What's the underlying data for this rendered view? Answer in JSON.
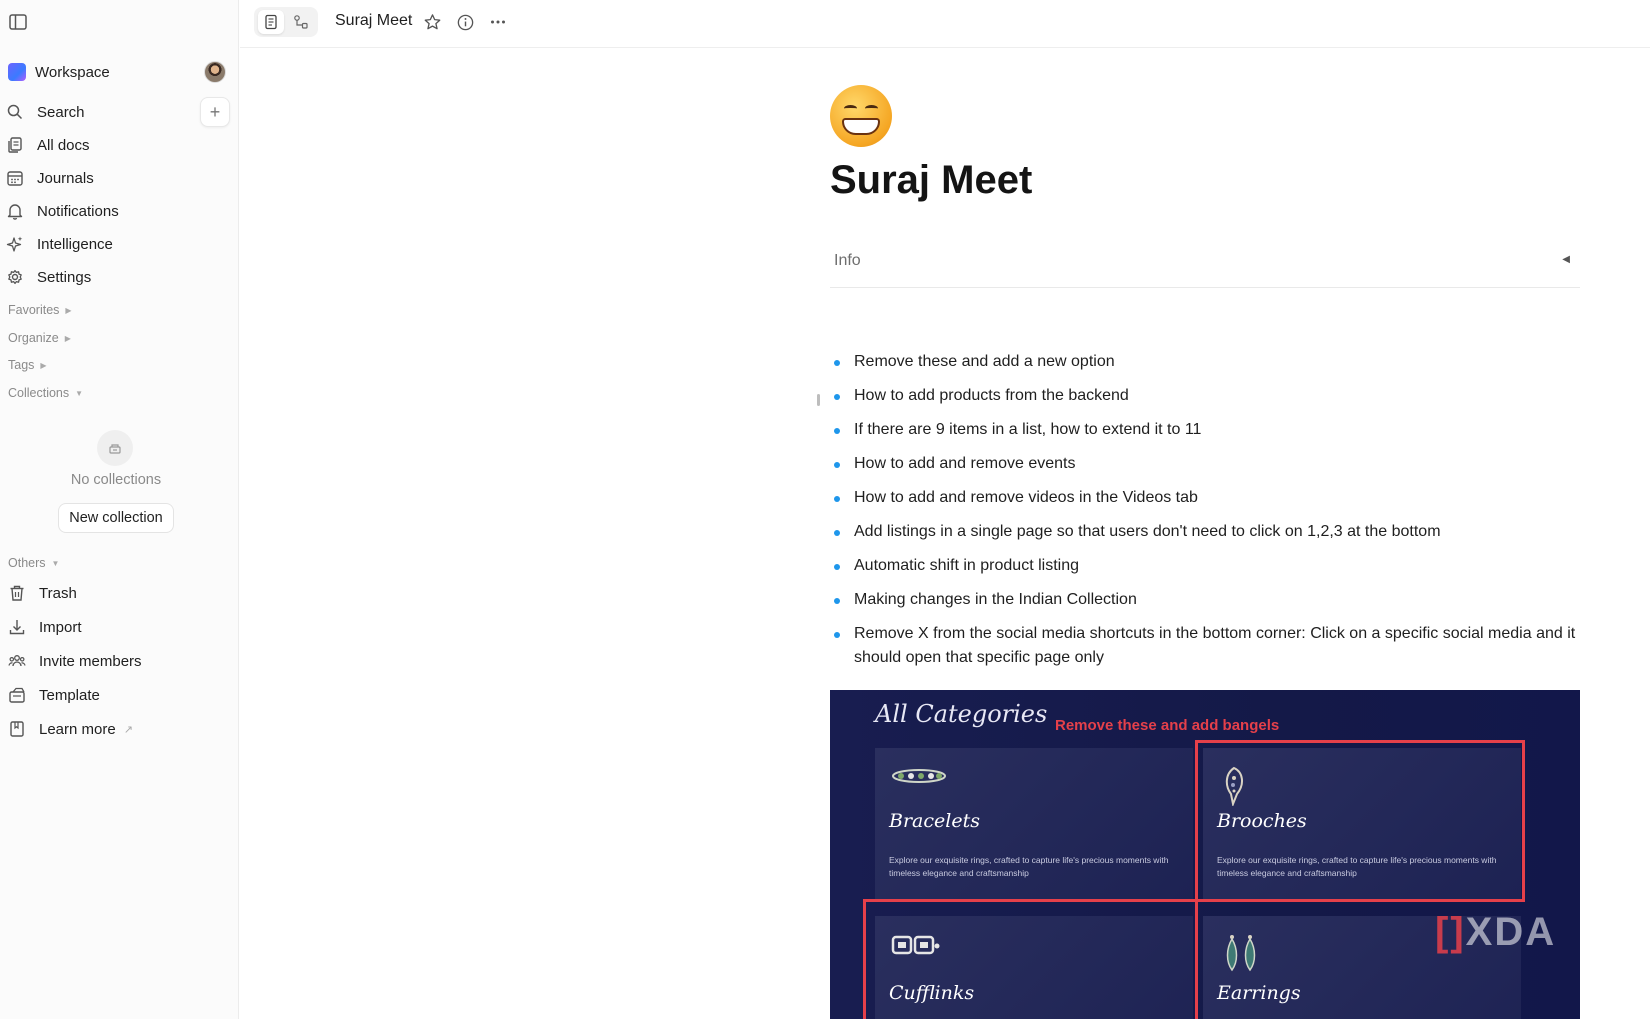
{
  "sidebar": {
    "workspace_name": "Workspace",
    "nav": [
      {
        "label": "Search",
        "icon": "search-icon"
      },
      {
        "label": "All docs",
        "icon": "docs-icon"
      },
      {
        "label": "Journals",
        "icon": "calendar-icon"
      },
      {
        "label": "Notifications",
        "icon": "bell-icon"
      },
      {
        "label": "Intelligence",
        "icon": "sparkle-icon"
      },
      {
        "label": "Settings",
        "icon": "gear-icon"
      }
    ],
    "sections": {
      "favorites": "Favorites",
      "organize": "Organize",
      "tags": "Tags",
      "collections": "Collections",
      "others": "Others"
    },
    "no_collections": "No collections",
    "new_collection": "New collection",
    "others": [
      {
        "label": "Trash",
        "icon": "trash-icon"
      },
      {
        "label": "Import",
        "icon": "import-icon"
      },
      {
        "label": "Invite members",
        "icon": "people-icon"
      },
      {
        "label": "Template",
        "icon": "template-icon"
      },
      {
        "label": "Learn more",
        "icon": "book-icon"
      }
    ]
  },
  "topbar": {
    "title": "Suraj Meet"
  },
  "document": {
    "emoji": "grinning-face",
    "title": "Suraj Meet",
    "info_label": "Info",
    "bullets": [
      "Remove these and add a new option",
      "How to add products from the backend",
      "If there are 9 items in a list, how to extend it to 11",
      "How to add and remove events",
      "How to add and remove videos in the Videos tab",
      "Add listings in a single page so that users don't need to click on 1,2,3 at the bottom",
      "Automatic shift in product listing",
      "Making changes in the Indian Collection",
      "Remove X from the social media shortcuts in the bottom corner: Click on a specific social media and it should open that specific page only"
    ],
    "image": {
      "heading": "All Categories",
      "annotation": "Remove these and add bangels",
      "cards": [
        {
          "name": "Bracelets",
          "desc": "Explore our exquisite rings, crafted to capture life's precious moments with timeless elegance and craftsmanship"
        },
        {
          "name": "Brooches",
          "desc": "Explore our exquisite rings, crafted to capture life's precious moments with timeless elegance and craftsmanship"
        },
        {
          "name": "Cufflinks",
          "desc": ""
        },
        {
          "name": "Earrings",
          "desc": ""
        }
      ],
      "watermark_left": "[]",
      "watermark_right": "XDA"
    }
  },
  "colors": {
    "accent_bullet": "#1e96eb",
    "annotation_red": "#e5404a",
    "image_bg": "#151a4a"
  }
}
